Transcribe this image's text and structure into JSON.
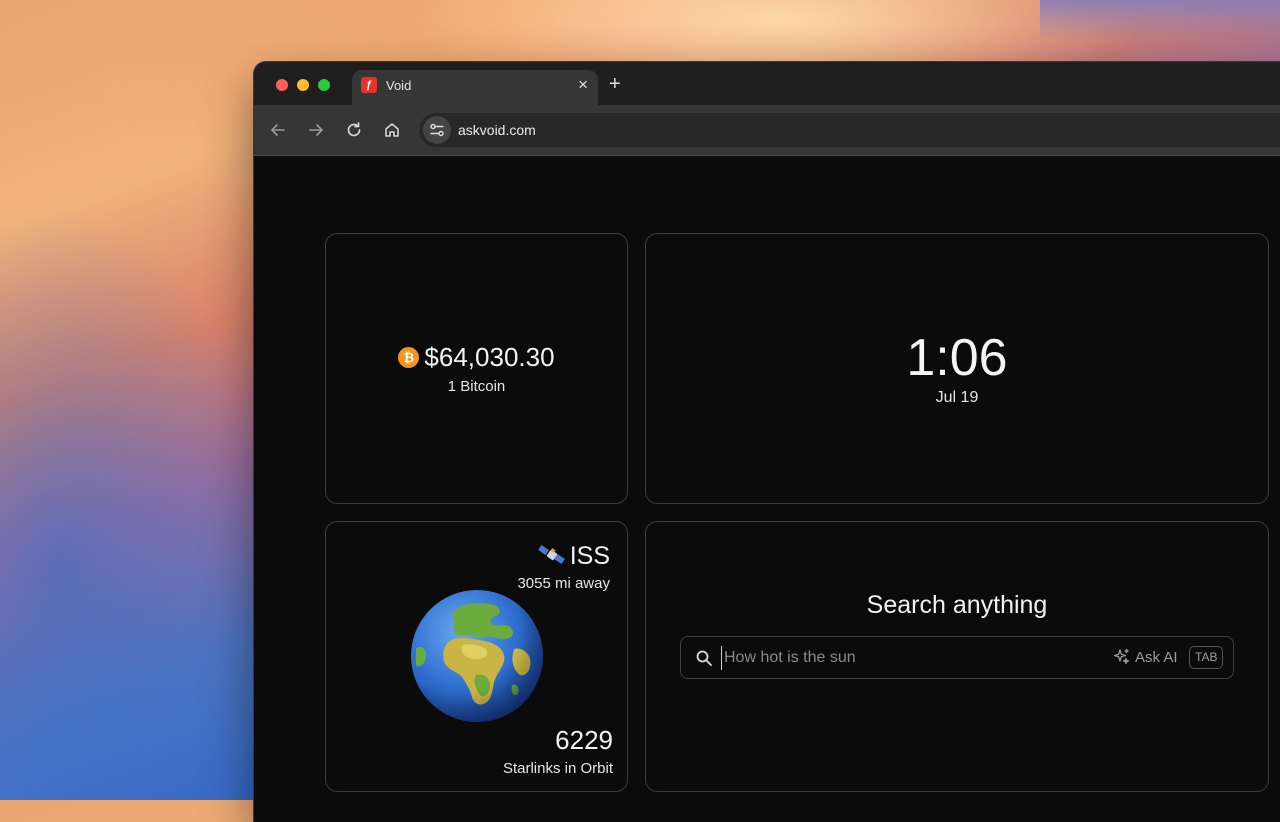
{
  "browser": {
    "tab": {
      "title": "Void",
      "favicon_icon": "void-logo-icon",
      "close_label": "×"
    },
    "new_tab_label": "+",
    "url": "askvoid.com"
  },
  "bitcoin_widget": {
    "icon": "bitcoin-icon",
    "icon_glyph": "₿",
    "price": "$64,030.30",
    "label": "1 Bitcoin"
  },
  "clock_widget": {
    "time": "1:06",
    "date": "Jul 19"
  },
  "iss_widget": {
    "title": "ISS",
    "satellite_icon": "satellite-icon",
    "distance": "3055 mi away",
    "globe_icon": "earth-globe-icon",
    "starlink_count": "6229",
    "starlink_label": "Starlinks in Orbit"
  },
  "search_widget": {
    "title": "Search anything",
    "placeholder": "How hot is the sun",
    "ask_ai_label": "Ask AI",
    "tab_key_label": "TAB"
  },
  "colors": {
    "accent_bitcoin": "#f7931a",
    "card_border": "#3b3b3b",
    "page_background": "#0b0b0b"
  }
}
